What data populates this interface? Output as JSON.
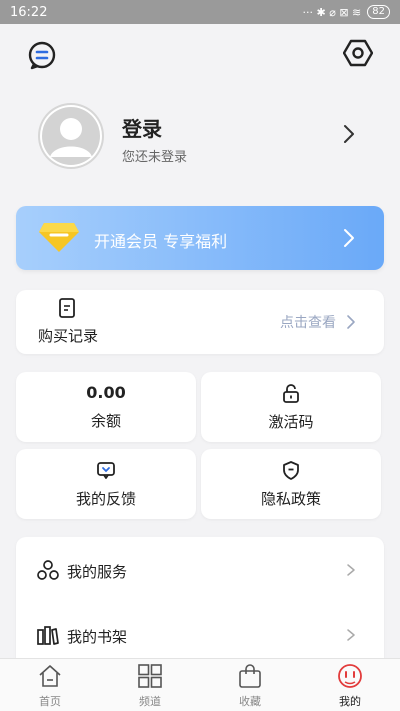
{
  "statusbar": {
    "time": "16:22",
    "icons": "··· ✱ ⌀ ⊠ ≋",
    "battery": "82"
  },
  "topbar": {
    "chat_icon": "chat-bubble-icon",
    "settings_icon": "hexagon-settings-icon"
  },
  "profile": {
    "title": "登录",
    "subtitle": "您还未登录"
  },
  "vip": {
    "text": "开通会员 专享福利",
    "accent": "#6aa9f8"
  },
  "purchase": {
    "label": "购买记录",
    "link": "点击查看"
  },
  "grid": {
    "balance_value": "0.00",
    "balance_label": "余额",
    "activation_label": "激活码",
    "feedback_label": "我的反馈",
    "privacy_label": "隐私政策"
  },
  "services": {
    "items": [
      {
        "label": "我的服务",
        "icon": "services-icon"
      },
      {
        "label": "我的书架",
        "icon": "bookshelf-icon"
      }
    ]
  },
  "tabbar": {
    "tabs": [
      {
        "label": "首页",
        "icon": "home-icon"
      },
      {
        "label": "频道",
        "icon": "grid-icon"
      },
      {
        "label": "收藏",
        "icon": "bag-icon"
      },
      {
        "label": "我的",
        "icon": "face-icon",
        "active": true
      }
    ],
    "active_color": "#e23b3b"
  }
}
